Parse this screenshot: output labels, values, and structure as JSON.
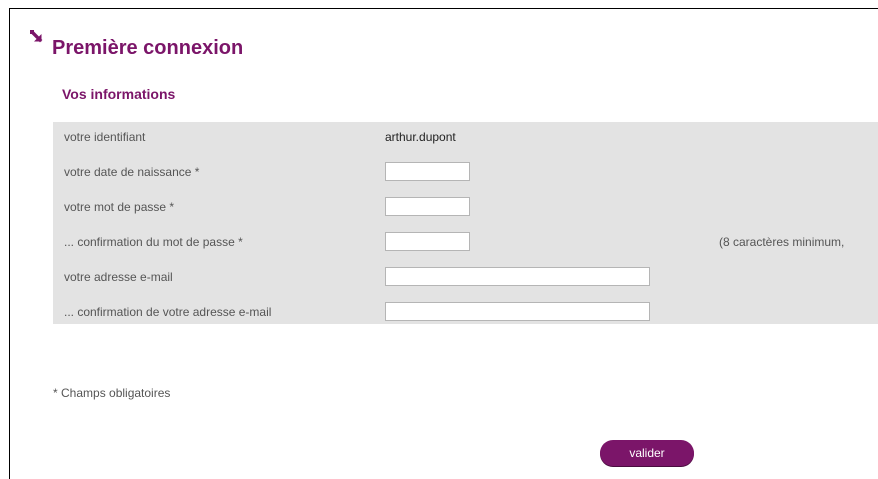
{
  "page": {
    "title": "Première connexion"
  },
  "section": {
    "title": "Vos informations"
  },
  "form": {
    "rows": [
      {
        "label": "votre identifiant",
        "value": "arthur.dupont"
      },
      {
        "label": "votre date de naissance *",
        "input_value": ""
      },
      {
        "label": "votre mot de passe *",
        "input_value": ""
      },
      {
        "label": "... confirmation du mot de passe *",
        "input_value": "",
        "hint": "(8 caractères minimum,"
      },
      {
        "label": "votre adresse e-mail",
        "input_value": ""
      },
      {
        "label": "... confirmation de votre adresse e-mail",
        "input_value": ""
      }
    ]
  },
  "footer": {
    "required_note": "* Champs obligatoires"
  },
  "actions": {
    "submit_label": "valider"
  },
  "colors": {
    "accent": "#7b1569",
    "panel_background": "#e3e3e3"
  }
}
